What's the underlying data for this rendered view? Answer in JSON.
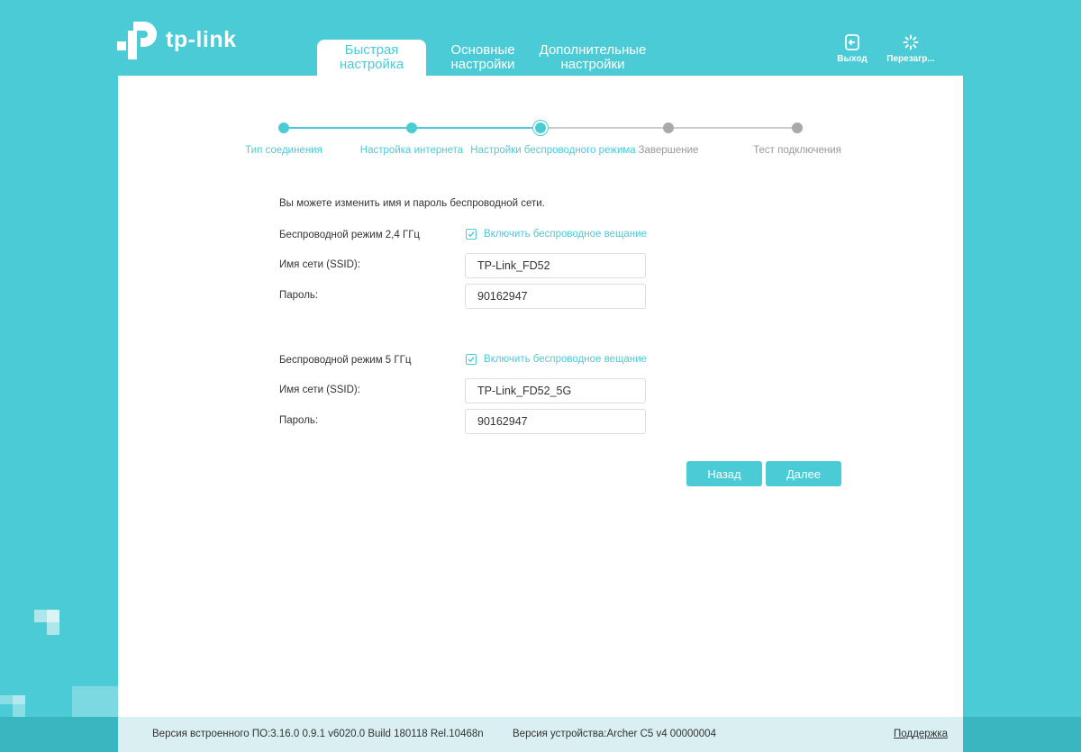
{
  "header": {
    "logo_text": "tp-link",
    "tabs": [
      {
        "line1": "Быстрая",
        "line2": "настройка"
      },
      {
        "line1": "Основные",
        "line2": "настройки"
      },
      {
        "line1": "Дополнительные",
        "line2": "настройки"
      }
    ],
    "logout_label": "Выход",
    "reboot_label": "Перезагр..."
  },
  "stepper": {
    "steps": [
      {
        "label": "Тип соединения",
        "state": "done"
      },
      {
        "label": "Настройка интернета",
        "state": "done"
      },
      {
        "label": "Настройки беспроводного режима",
        "state": "current"
      },
      {
        "label": "Завершение",
        "state": "todo"
      },
      {
        "label": "Тест подключения",
        "state": "todo"
      }
    ]
  },
  "form": {
    "intro": "Вы можете изменить имя и пароль беспроводной сети.",
    "band24": {
      "label": "Беспроводной режим 2,4 ГГц",
      "broadcast_label": "Включить беспроводное вещание",
      "broadcast_checked": true,
      "ssid_label": "Имя сети (SSID):",
      "ssid_value": "TP-Link_FD52",
      "password_label": "Пароль:",
      "password_value": "90162947"
    },
    "band5": {
      "label": "Беспроводной режим 5 ГГц",
      "broadcast_label": "Включить беспроводное вещание",
      "broadcast_checked": true,
      "ssid_label": "Имя сети (SSID):",
      "ssid_value": "TP-Link_FD52_5G",
      "password_label": "Пароль:",
      "password_value": "90162947"
    },
    "back_label": "Назад",
    "next_label": "Далее"
  },
  "footer": {
    "firmware": "Версия встроенного ПО:3.16.0 0.9.1 v6020.0 Build 180118 Rel.10468n",
    "hardware": "Версия устройства:Archer C5 v4 00000004",
    "support": "Поддержка"
  },
  "colors": {
    "accent": "#4acbd6",
    "inactive": "#a9a9a9",
    "footer_bg": "#d9eff1"
  }
}
